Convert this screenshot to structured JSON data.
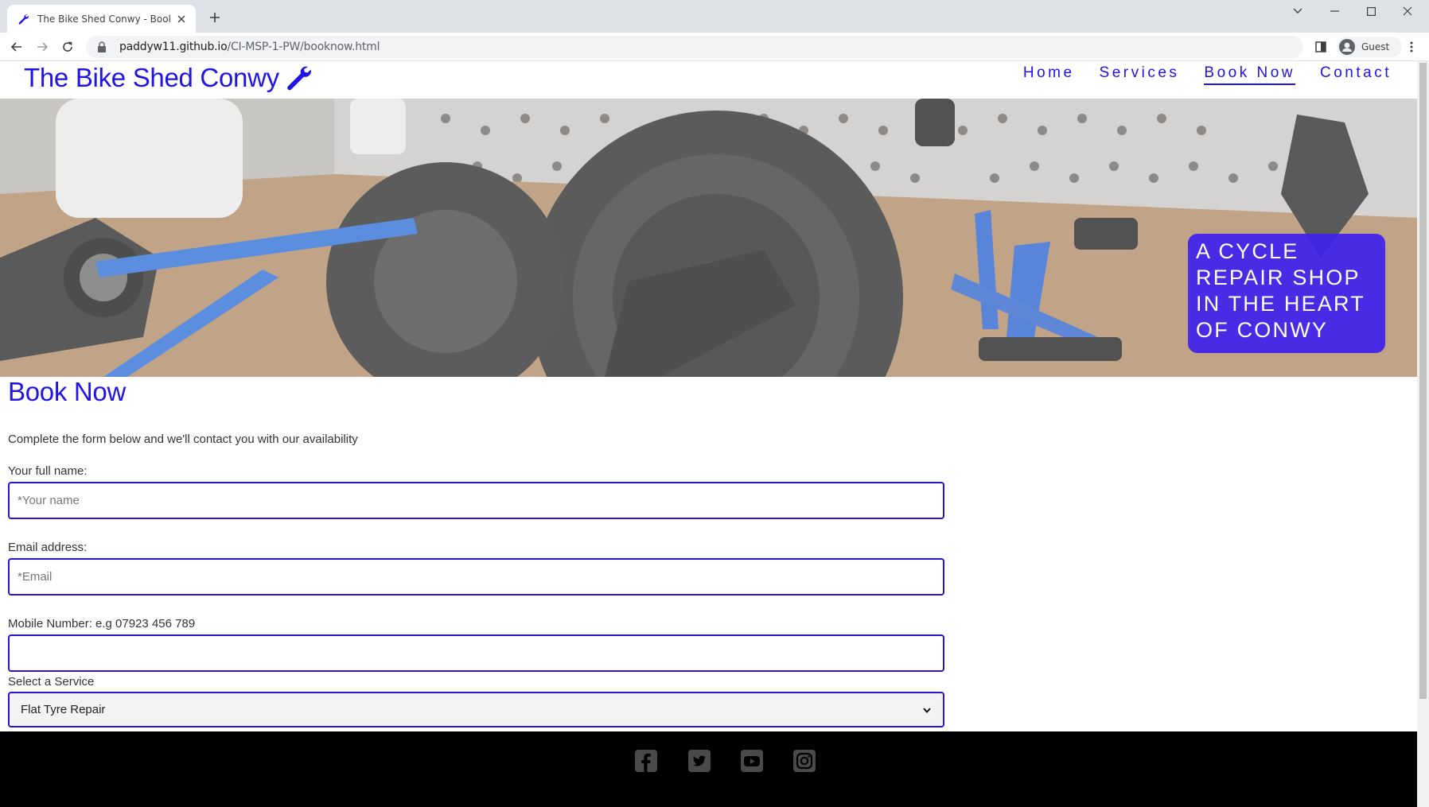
{
  "browser": {
    "tab_title": "The Bike Shed Conwy - Book Now",
    "url_domain": "paddyw11.github.io",
    "url_path": "/CI-MSP-1-PW/booknow.html",
    "profile_label": "Guest"
  },
  "site": {
    "brand": "The Bike Shed Conwy",
    "brand_icon": "wrench-icon",
    "nav": [
      {
        "label": "Home",
        "active": false
      },
      {
        "label": "Services",
        "active": false
      },
      {
        "label": "Book Now",
        "active": true
      },
      {
        "label": "Contact",
        "active": false
      }
    ],
    "tagline": "A CYCLE REPAIR SHOP IN THE HEART OF CONWY"
  },
  "form": {
    "heading": "Book Now",
    "intro": "Complete the form below and we'll contact you with our availability",
    "name_label": "Your full name:",
    "name_placeholder": "*Your name",
    "email_label": "Email address:",
    "email_placeholder": "*Email",
    "mobile_label": "Mobile Number: e.g 07923 456 789",
    "service_label": "Select a Service",
    "service_selected": "Flat Tyre Repair"
  },
  "footer": {
    "social": [
      "facebook-icon",
      "twitter-icon",
      "youtube-icon",
      "instagram-icon"
    ]
  },
  "colors": {
    "brand_blue": "#1f13e6",
    "field_border": "#2a12d8",
    "footer_bg": "#000000"
  }
}
